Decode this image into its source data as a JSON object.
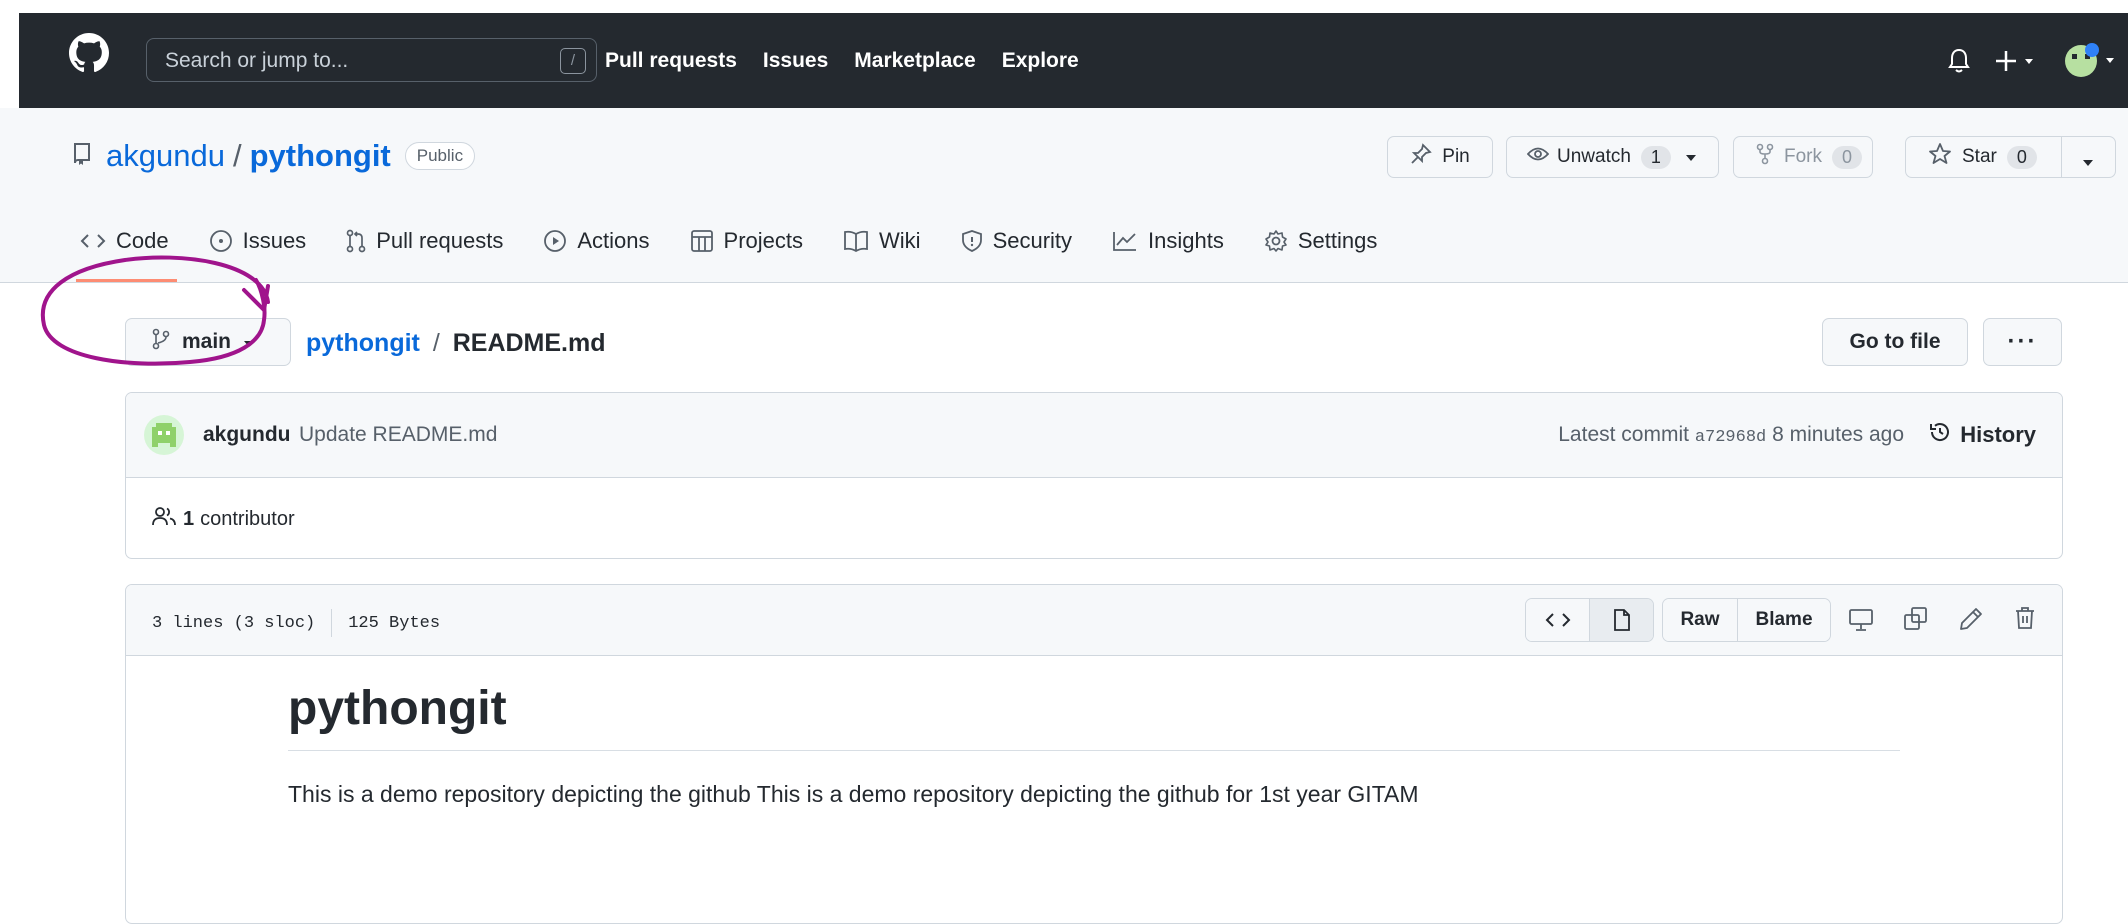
{
  "header": {
    "search_placeholder": "Search or jump to...",
    "slash_key": "/",
    "nav": [
      "Pull requests",
      "Issues",
      "Marketplace",
      "Explore"
    ],
    "icons": [
      "github-logo-icon",
      "bell-icon",
      "plus-icon",
      "avatar"
    ]
  },
  "repo": {
    "owner": "akgundu",
    "separator": "/",
    "name": "pythongit",
    "visibility": "Public",
    "pin_label": "Pin",
    "unwatch_label": "Unwatch",
    "watch_count": "1",
    "fork_label": "Fork",
    "fork_count": "0",
    "star_label": "Star",
    "star_count": "0"
  },
  "tabs": [
    {
      "label": "Code",
      "icon": "code-icon",
      "active": true
    },
    {
      "label": "Issues",
      "icon": "issue-icon"
    },
    {
      "label": "Pull requests",
      "icon": "pull-request-icon"
    },
    {
      "label": "Actions",
      "icon": "play-icon"
    },
    {
      "label": "Projects",
      "icon": "table-icon"
    },
    {
      "label": "Wiki",
      "icon": "book-icon"
    },
    {
      "label": "Security",
      "icon": "shield-icon"
    },
    {
      "label": "Insights",
      "icon": "graph-icon"
    },
    {
      "label": "Settings",
      "icon": "gear-icon"
    }
  ],
  "file_nav": {
    "branch": "main",
    "repo_link": "pythongit",
    "separator": "/",
    "file": "README.md",
    "go_to_file": "Go to file",
    "more": "···"
  },
  "commit": {
    "author": "akgundu",
    "message": "Update README.md",
    "latest_prefix": "Latest commit",
    "sha": "a72968d",
    "time": "8 minutes ago",
    "history": "History",
    "contributors_count": "1",
    "contributors_label": "contributor"
  },
  "file": {
    "lines": "3 lines (3 sloc)",
    "size": "125 Bytes",
    "raw": "Raw",
    "blame": "Blame"
  },
  "readme": {
    "heading": "pythongit",
    "text": "This is a demo repository depicting the github This is a demo repository depicting the github for 1st year GITAM"
  },
  "colors": {
    "header_bg": "#24292f",
    "link": "#0969da",
    "active_tab_underline": "#fd8c73",
    "annotation": "#a0148c"
  }
}
